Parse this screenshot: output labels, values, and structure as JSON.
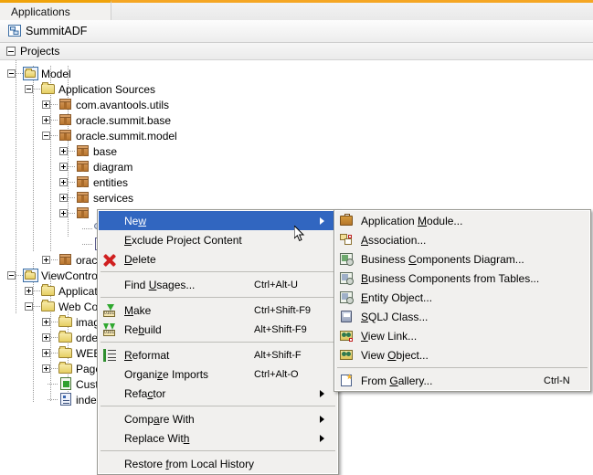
{
  "window": {
    "tab_label": "Applications",
    "application_name": "SummitADF",
    "projects_label": "Projects",
    "accent_color": "#f5a623",
    "selection_color": "#3166c0"
  },
  "tree": {
    "nodes": [
      {
        "label": "Model",
        "icon": "project-folder-icon",
        "indent": 0,
        "toggle": "minus"
      },
      {
        "label": "Application Sources",
        "icon": "folder-icon",
        "indent": 1,
        "toggle": "minus"
      },
      {
        "label": "com.avantools.utils",
        "icon": "package-icon",
        "indent": 2,
        "toggle": "plus"
      },
      {
        "label": "oracle.summit.base",
        "icon": "package-icon",
        "indent": 2,
        "toggle": "plus"
      },
      {
        "label": "oracle.summit.model",
        "icon": "package-icon",
        "indent": 2,
        "toggle": "minus"
      },
      {
        "label": "base",
        "icon": "package-icon",
        "indent": 3,
        "toggle": "plus"
      },
      {
        "label": "diagram",
        "icon": "package-icon",
        "indent": 3,
        "toggle": "plus"
      },
      {
        "label": "entities",
        "icon": "package-icon",
        "indent": 3,
        "toggle": "plus"
      },
      {
        "label": "services",
        "icon": "package-icon",
        "indent": 3,
        "toggle": "plus"
      },
      {
        "label": "",
        "icon": "package-icon",
        "indent": 3,
        "toggle": "plus"
      },
      {
        "label": "",
        "icon": "diagram-icon",
        "indent": 4,
        "toggle": "none"
      },
      {
        "label": "",
        "icon": "document-icon",
        "indent": 4,
        "toggle": "none"
      },
      {
        "label": "orac",
        "icon": "package-icon",
        "indent": 2,
        "toggle": "plus"
      },
      {
        "label": "ViewControlle",
        "icon": "project-folder-icon",
        "indent": 0,
        "toggle": "minus"
      },
      {
        "label": "Applicati",
        "icon": "folder-icon",
        "indent": 1,
        "toggle": "plus"
      },
      {
        "label": "Web Con",
        "icon": "folder-icon",
        "indent": 1,
        "toggle": "minus"
      },
      {
        "label": "imag",
        "icon": "folder-icon",
        "indent": 2,
        "toggle": "plus"
      },
      {
        "label": "orde",
        "icon": "folder-icon",
        "indent": 2,
        "toggle": "plus"
      },
      {
        "label": "WEB",
        "icon": "folder-icon",
        "indent": 2,
        "toggle": "plus"
      },
      {
        "label": "Page",
        "icon": "folder-icon",
        "indent": 2,
        "toggle": "plus"
      },
      {
        "label": "Cust",
        "icon": "config-green-icon",
        "indent": 2,
        "toggle": "none"
      },
      {
        "label": "inde",
        "icon": "config-icon",
        "indent": 2,
        "toggle": "none"
      }
    ]
  },
  "context_menu": {
    "items": [
      {
        "label": "New",
        "mnemonic": "w",
        "accel": "",
        "icon": "",
        "submenu": true,
        "selected": true
      },
      {
        "label": "Exclude Project Content",
        "mnemonic": "E",
        "accel": "",
        "icon": "",
        "submenu": false,
        "selected": false
      },
      {
        "label": "Delete",
        "mnemonic": "D",
        "accel": "",
        "icon": "delete-icon",
        "submenu": false,
        "selected": false
      },
      {
        "separator": true
      },
      {
        "label": "Find Usages...",
        "mnemonic": "U",
        "accel": "Ctrl+Alt-U",
        "icon": "",
        "submenu": false,
        "selected": false
      },
      {
        "separator": true
      },
      {
        "label": "Make",
        "mnemonic": "M",
        "accel": "Ctrl+Shift-F9",
        "icon": "make-icon",
        "submenu": false,
        "selected": false
      },
      {
        "label": "Rebuild",
        "mnemonic": "b",
        "accel": "Alt+Shift-F9",
        "icon": "rebuild-icon",
        "submenu": false,
        "selected": false
      },
      {
        "separator": true
      },
      {
        "label": "Reformat",
        "mnemonic": "R",
        "accel": "Alt+Shift-F",
        "icon": "reformat-icon",
        "submenu": false,
        "selected": false
      },
      {
        "label": "Organize Imports",
        "mnemonic": "z",
        "accel": "Ctrl+Alt-O",
        "icon": "",
        "submenu": false,
        "selected": false
      },
      {
        "label": "Refactor",
        "mnemonic": "c",
        "accel": "",
        "icon": "",
        "submenu": true,
        "selected": false
      },
      {
        "separator": true
      },
      {
        "label": "Compare With",
        "mnemonic": "a",
        "accel": "",
        "icon": "",
        "submenu": true,
        "selected": false
      },
      {
        "label": "Replace With",
        "mnemonic": "h",
        "accel": "",
        "icon": "",
        "submenu": true,
        "selected": false
      },
      {
        "separator": true
      },
      {
        "label": "Restore from Local History",
        "mnemonic": "f",
        "accel": "",
        "icon": "",
        "submenu": false,
        "selected": false
      }
    ]
  },
  "new_submenu": {
    "items": [
      {
        "label": "Application Module...",
        "mnemonic": "M",
        "accel": "",
        "icon": "application-module-icon"
      },
      {
        "label": "Association...",
        "mnemonic": "A",
        "accel": "",
        "icon": "association-icon"
      },
      {
        "label": "Business Components Diagram...",
        "mnemonic": "C",
        "accel": "",
        "icon": "business-components-diagram-icon"
      },
      {
        "label": "Business Components from Tables...",
        "mnemonic": "B",
        "accel": "",
        "icon": "business-components-tables-icon"
      },
      {
        "label": "Entity Object...",
        "mnemonic": "E",
        "accel": "",
        "icon": "entity-object-icon"
      },
      {
        "label": "SQLJ Class...",
        "mnemonic": "S",
        "accel": "",
        "icon": "sqlj-class-icon"
      },
      {
        "label": "View Link...",
        "mnemonic": "V",
        "accel": "",
        "icon": "view-link-icon"
      },
      {
        "label": "View Object...",
        "mnemonic": "O",
        "accel": "",
        "icon": "view-object-icon"
      },
      {
        "separator": true
      },
      {
        "label": "From Gallery...",
        "mnemonic": "G",
        "accel": "Ctrl-N",
        "icon": "from-gallery-icon"
      }
    ]
  }
}
